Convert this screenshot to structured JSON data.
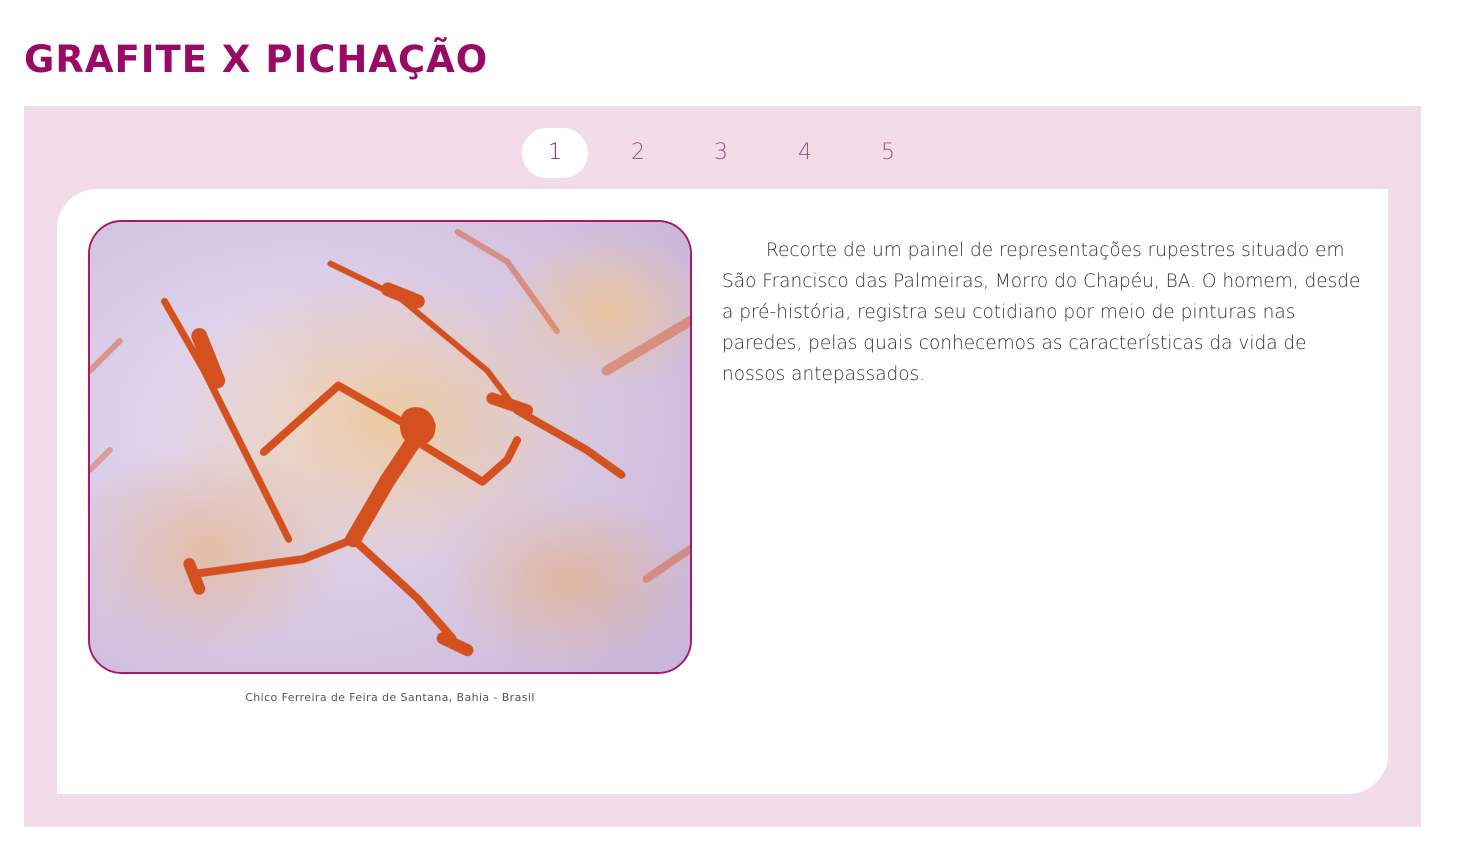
{
  "page": {
    "title": "GRAFITE X PICHAÇÃO"
  },
  "tabs": [
    {
      "label": "1",
      "active": true
    },
    {
      "label": "2",
      "active": false
    },
    {
      "label": "3",
      "active": false
    },
    {
      "label": "4",
      "active": false
    },
    {
      "label": "5",
      "active": false
    }
  ],
  "slide": {
    "image_alt": "Pintura rupestre de figura humana com lanças",
    "credit": "Chico Ferreira de Feira de Santana, Bahia - Brasil",
    "description": "Recorte de um painel de representações rupestres situado em São Francisco das Palmeiras, Morro do Chapéu, BA. O homem, desde a pré-história, registra seu cotidiano por meio de pinturas nas paredes, pelas quais conhecemos as características da vida de nossos antepassados."
  },
  "colors": {
    "title": "#990a66",
    "panel_background": "#f2dce8",
    "tab_text": "#a04f80",
    "photo_border": "#a8196e",
    "paint": "#d9542a"
  },
  "icons": {
    "photo": "rock-painting-image"
  }
}
